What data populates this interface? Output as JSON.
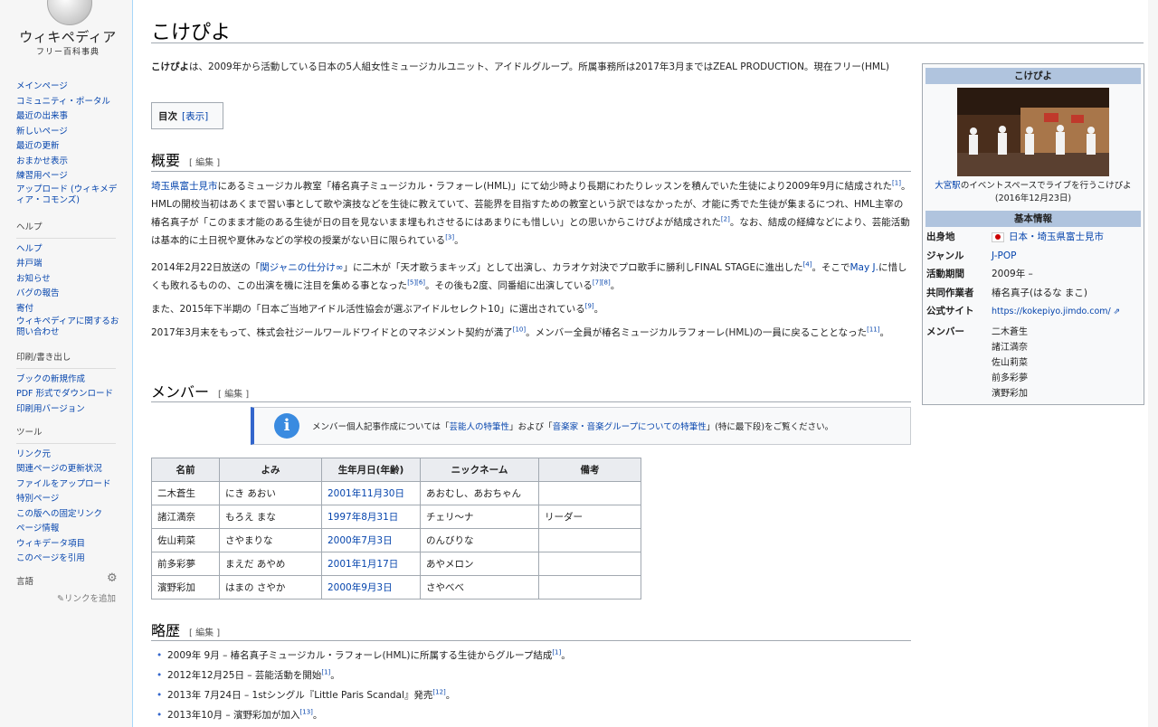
{
  "logo": {
    "wordmark": "ウィキペディア",
    "tagline": "フリー百科事典"
  },
  "sidebar": {
    "main": [
      "メインページ",
      "コミュニティ・ポータル",
      "最近の出来事",
      "新しいページ",
      "最近の更新",
      "おまかせ表示",
      "練習用ページ",
      "アップロード (ウィキメディア・コモンズ)"
    ],
    "help_head": "ヘルプ",
    "help": [
      "ヘルプ",
      "井戸端",
      "お知らせ",
      "バグの報告",
      "寄付",
      "ウィキペディアに関するお問い合わせ"
    ],
    "print_head": "印刷/書き出し",
    "print": [
      "ブックの新規作成",
      "PDF 形式でダウンロード",
      "印刷用バージョン"
    ],
    "tools_head": "ツール",
    "tools": [
      "リンク元",
      "関連ページの更新状況",
      "ファイルをアップロード",
      "特別ページ",
      "この版への固定リンク",
      "ページ情報",
      "ウィキデータ項目",
      "このページを引用"
    ],
    "lang_head": "言語",
    "add_links": "リンクを追加"
  },
  "article": {
    "title": "こけぴよ",
    "lead_bold": "こけぴよ",
    "lead_rest": "は、2009年から活動している日本の5人組女性ミュージカルユニット、アイドルグループ。所属事務所は2017年3月まではZEAL PRODUCTION。現在フリー(HML)",
    "toc_label": "目次",
    "toc_toggle": "[表示]",
    "sec1": "概要",
    "edit": "[ 編集 ]",
    "p1_link": "埼玉県富士見市",
    "p1_a": "にあるミュージカル教室「椿名真子ミュージカル・ラフォーレ(HML)」にて幼少時より長期にわたりレッスンを積んでいた生徒により2009年9月に結成された",
    "r1": "[1]",
    "p1_b": "。HMLの開校当初はあくまで習い事として歌や演技などを生徒に教えていて、芸能界を目指すための教室という訳ではなかったが、才能に秀でた生徒が集まるにつれ、HML主宰の椿名真子が「このまま才能のある生徒が日の目を見ないまま埋もれさせるにはあまりにも惜しい」との思いからこけぴよが結成された",
    "r2": "[2]",
    "p1_c": "。なお、結成の経緯などにより、芸能活動は基本的に土日祝や夏休みなどの学校の授業がない日に限られている",
    "r3": "[3]",
    "p1_d": "。",
    "p2_a": "2014年2月22日放送の「",
    "p2_link1": "関ジャニの仕分け∞",
    "p2_b": "」に二木が「天才歌うまキッズ」として出演し、カラオケ対決でプロ歌手に勝利しFINAL STAGEに進出した",
    "r4": "[4]",
    "p2_c": "。そこで",
    "p2_link2": "May J.",
    "p2_d": "に惜しくも敗れるものの、この出演を機に注目を集める事となった",
    "r56": "[5][6]",
    "p2_e": "。その後も2度、同番組に出演している",
    "r78": "[7][8]",
    "p2_f": "。",
    "p3_a": "また、2015年下半期の「日本ご当地アイドル活性協会が選ぶアイドルセレクト10」に選出されている",
    "r9": "[9]",
    "p3_b": "。",
    "p4_a": "2017年3月末をもって、株式会社ジールワールドワイドとのマネジメント契約が満了",
    "r10": "[10]",
    "p4_b": "。メンバー全員が椿名ミュージカルラフォーレ(HML)の一員に戻ることとなった",
    "r11": "[11]",
    "p4_c": "。",
    "sec2": "メンバー",
    "notice_a": "メンバー個人記事作成については「",
    "notice_l1": "芸能人の特筆性",
    "notice_b": "」および「",
    "notice_l2": "音楽家・音楽グループについての特筆性",
    "notice_c": "」(特に最下段)をご覧ください。",
    "sec3": "略歴"
  },
  "members_table": {
    "headers": [
      "名前",
      "よみ",
      "生年月日(年齢)",
      "ニックネーム",
      "備考"
    ],
    "rows": [
      [
        "二木蒼生",
        "にき あおい",
        "2001年11月30日",
        "あおむし、あおちゃん",
        ""
      ],
      [
        "諸江満奈",
        "もろえ まな",
        "1997年8月31日",
        "チェリ〜ナ",
        "リーダー"
      ],
      [
        "佐山莉菜",
        "さやまりな",
        "2000年7月3日",
        "のんびりな",
        ""
      ],
      [
        "前多彩夢",
        "まえだ あやめ",
        "2001年1月17日",
        "あやメロン",
        ""
      ],
      [
        "濱野彩加",
        "はまの さやか",
        "2000年9月3日",
        "さやべべ",
        ""
      ]
    ]
  },
  "history": [
    {
      "text": "2009年 9月 – 椿名真子ミュージカル・ラフォーレ(HML)に所属する生徒からグループ結成",
      "ref": "[1]",
      "end": "。"
    },
    {
      "text": "2012年12月25日 – 芸能活動を開始",
      "ref": "[1]",
      "end": "。"
    },
    {
      "text": "2013年 7月24日 – 1stシングル『Little Paris Scandal』発売",
      "ref": "[12]",
      "end": "。"
    },
    {
      "text": "2013年10月 – 濱野彩加が加入",
      "ref": "[13]",
      "end": "。"
    }
  ],
  "infobox": {
    "title": "こけぴよ",
    "caption_link": "大宮駅",
    "caption_rest": "のイベントスペースでライブを行うこけぴよ(2016年12月23日)",
    "subhead": "基本情報",
    "origin_key": "出身地",
    "origin_val": "日本・埼玉県富士見市",
    "genre_key": "ジャンル",
    "genre_val": "J-POP",
    "period_key": "活動期間",
    "period_val": "2009年 –",
    "collab_key": "共同作業者",
    "collab_val": "椿名真子(はるな まこ)",
    "site_key": "公式サイト",
    "site_val": "https://kokepiyo.jimdo.com/",
    "members_key": "メンバー",
    "members": [
      "二木蒼生",
      "諸江満奈",
      "佐山莉菜",
      "前多彩夢",
      "濱野彩加"
    ]
  }
}
